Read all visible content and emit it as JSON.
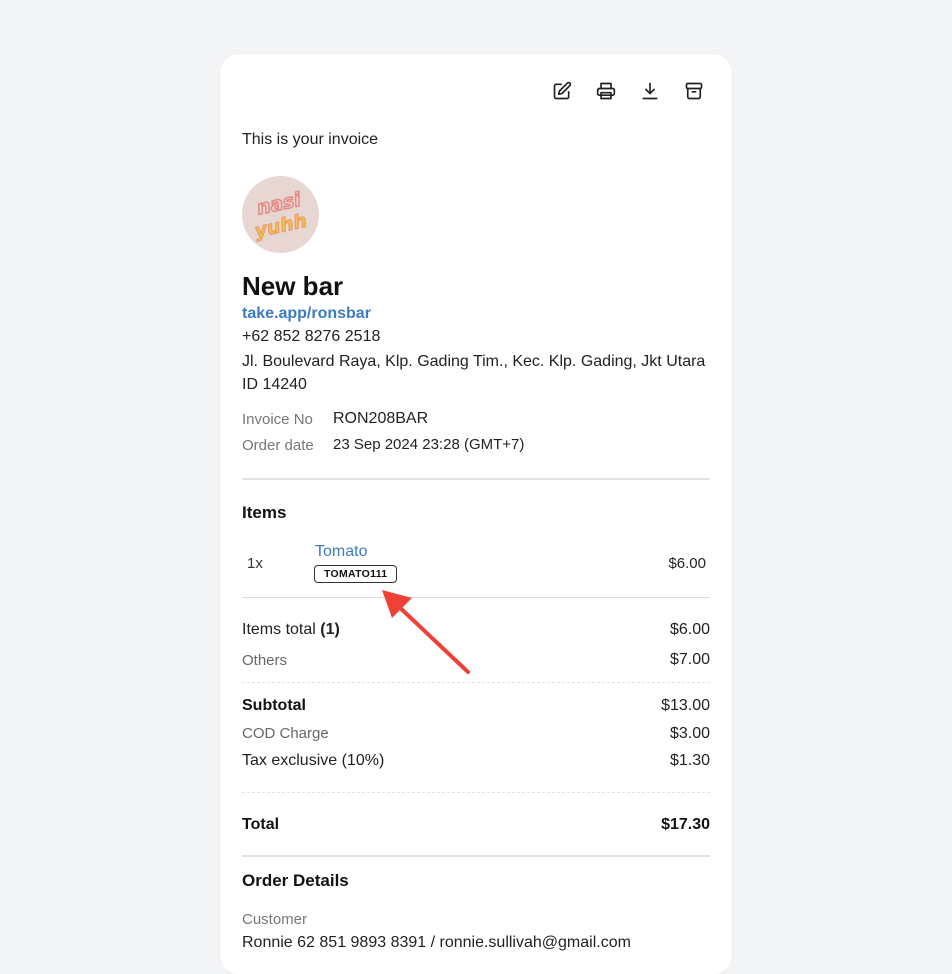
{
  "toolbar": {
    "edit_icon": "edit-icon",
    "print_icon": "print-icon",
    "download_icon": "download-icon",
    "archive_icon": "archive-icon"
  },
  "intro_text": "This is your invoice",
  "store": {
    "logo_text": [
      "nasi",
      "yuhh"
    ],
    "name": "New bar",
    "link": "take.app/ronsbar",
    "phone": "+62 852 8276 2518",
    "address": "Jl. Boulevard Raya, Klp. Gading Tim., Kec. Klp. Gading, Jkt Utara ID 14240"
  },
  "invoice": {
    "invoice_no_label": "Invoice No",
    "invoice_no": "RON208BAR",
    "order_date_label": "Order date",
    "order_date": "23 Sep 2024 23:28 (GMT+7)"
  },
  "items_section": {
    "title": "Items",
    "items": [
      {
        "qty": "1x",
        "name": "Tomato",
        "sku": "TOMATO111",
        "price": "$6.00"
      }
    ]
  },
  "summary": {
    "items_total_label": "Items total",
    "items_total_count": "(1)",
    "items_total": "$6.00",
    "others_label": "Others",
    "others": "$7.00",
    "subtotal_label": "Subtotal",
    "subtotal": "$13.00",
    "cod_label": "COD Charge",
    "cod": "$3.00",
    "tax_label": "Tax exclusive (10%)",
    "tax": "$1.30",
    "total_label": "Total",
    "total": "$17.30"
  },
  "order_details": {
    "title": "Order Details",
    "customer_label": "Customer",
    "customer_value": "Ronnie  62 851 9893 8391  /  ronnie.sullivah@gmail.com"
  },
  "colors": {
    "link": "#3d7bc4",
    "annotation_arrow": "#ef4136",
    "background": "#f3f4f6"
  }
}
